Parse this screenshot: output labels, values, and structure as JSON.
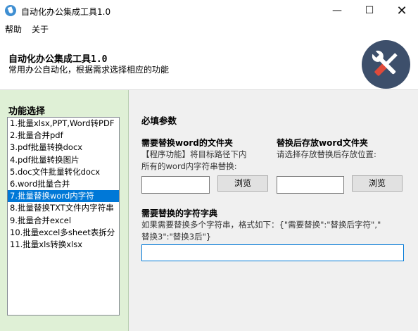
{
  "window": {
    "title": "自动化办公集成工具1.0",
    "minimize_icon": "minimize-icon",
    "maximize_icon": "maximize-icon",
    "close_icon": "close-icon"
  },
  "menu": [
    "帮助",
    "关于"
  ],
  "header": {
    "title": "自动化办公集成工具1.0",
    "subtitle": "常用办公自动化，根据需求选择相应的功能",
    "logo_icon": "tools-wrench-screwdriver-icon",
    "logo_bg": "#3d4f6b"
  },
  "sidebar": {
    "title": "功能选择",
    "items": [
      "1.批量xlsx,PPT,Word转PDF",
      "2.批量合并pdf",
      "3.pdf批量转换docx",
      "4.pdf批量转换图片",
      "5.doc文件批量转化docx",
      "6.word批量合并",
      "7.批量替换word内字符",
      "8.批量替换TXT文件内字符串",
      "9.批量合并excel",
      "10.批量excel多sheet表拆分",
      "11.批量xls转换xlsx"
    ],
    "selected_index": 6,
    "selected_color": "#0078d7",
    "panel_bg": "#dff0d6"
  },
  "main": {
    "section_title": "必填参数",
    "source": {
      "title": "需要替换word的文件夹",
      "hint_line1": "【程序功能】将目标路径下内",
      "hint_line2": "所有的word内字符串替换:",
      "input_value": "",
      "browse_label": "浏览"
    },
    "target": {
      "title": "替换后存放word文件夹",
      "hint": "请选择存放替换后存放位置:",
      "input_value": "",
      "browse_label": "浏览"
    },
    "dict": {
      "title": "需要替换的字符字典",
      "hint_line1": "如果需要替换多个字符串，格式如下：{\"需要替换\":\"替换后字符\",\"",
      "hint_line2": "替换3\":\"替换3后\"}",
      "input_value": ""
    }
  }
}
